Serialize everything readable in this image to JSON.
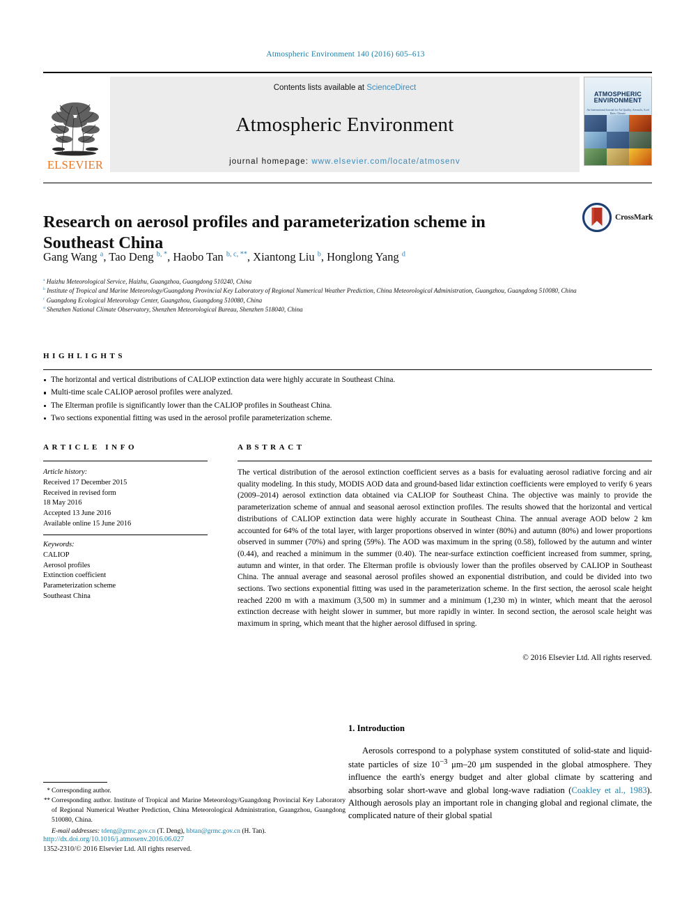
{
  "running_head": "Atmospheric Environment 140 (2016) 605–613",
  "banner": {
    "publisher": "ELSEVIER",
    "contents_prefix": "Contents lists available at ",
    "contents_link": "ScienceDirect",
    "journal_name": "Atmospheric Environment",
    "homepage_prefix": "journal homepage: ",
    "homepage_url": "www.elsevier.com/locate/atmosenv",
    "cover_title_line1": "ATMOSPHERIC",
    "cover_title_line2": "ENVIRONMENT",
    "cover_subtitle": "An International Journal for Air Quality, Aerosols, Acid Rain, Climate"
  },
  "article": {
    "title": "Research on aerosol profiles and parameterization scheme in Southeast China",
    "crossmark_label": "CrossMark",
    "authors": [
      {
        "name": "Gang Wang",
        "marks": "a"
      },
      {
        "name": "Tao Deng",
        "marks": "b, *"
      },
      {
        "name": "Haobo Tan",
        "marks": "b, c, **"
      },
      {
        "name": "Xiantong Liu",
        "marks": "b"
      },
      {
        "name": "Honglong Yang",
        "marks": "d"
      }
    ],
    "affiliations": [
      {
        "mark": "a",
        "text": "Haizhu Meteorological Service, Haizhu, Guangzhou, Guangdong 510240, China"
      },
      {
        "mark": "b",
        "text": "Institute of Tropical and Marine Meteorology/Guangdong Provincial Key Laboratory of Regional Numerical Weather Prediction, China Meteorological Administration, Guangzhou, Guangdong 510080, China"
      },
      {
        "mark": "c",
        "text": "Guangdong Ecological Meteorology Center, Guangzhou, Guangdong 510080, China"
      },
      {
        "mark": "d",
        "text": "Shenzhen National Climate Observatory, Shenzhen Meteorological Bureau, Shenzhen 518040, China"
      }
    ]
  },
  "highlights": {
    "heading": "HIGHLIGHTS",
    "items": [
      "The horizontal and vertical distributions of CALIOP extinction data were highly accurate in Southeast China.",
      "Multi-time scale CALIOP aerosol profiles were analyzed.",
      "The Elterman profile is significantly lower than the CALIOP profiles in Southeast China.",
      "Two sections exponential fitting was used in the aerosol profile parameterization scheme."
    ]
  },
  "article_info": {
    "heading": "ARTICLE INFO",
    "history_label": "Article history:",
    "history": [
      "Received 17 December 2015",
      "Received in revised form",
      "18 May 2016",
      "Accepted 13 June 2016",
      "Available online 15 June 2016"
    ],
    "keywords_label": "Keywords:",
    "keywords": [
      "CALIOP",
      "Aerosol profiles",
      "Extinction coefficient",
      "Parameterization scheme",
      "Southeast China"
    ]
  },
  "abstract": {
    "heading": "ABSTRACT",
    "text": "The vertical distribution of the aerosol extinction coefficient serves as a basis for evaluating aerosol radiative forcing and air quality modeling. In this study, MODIS AOD data and ground-based lidar extinction coefficients were employed to verify 6 years (2009–2014) aerosol extinction data obtained via CALIOP for Southeast China. The objective was mainly to provide the parameterization scheme of annual and seasonal aerosol extinction profiles. The results showed that the horizontal and vertical distributions of CALIOP extinction data were highly accurate in Southeast China. The annual average AOD below 2 km accounted for 64% of the total layer, with larger proportions observed in winter (80%) and autumn (80%) and lower proportions observed in summer (70%) and spring (59%). The AOD was maximum in the spring (0.58), followed by the autumn and winter (0.44), and reached a minimum in the summer (0.40). The near-surface extinction coefficient increased from summer, spring, autumn and winter, in that order. The Elterman profile is obviously lower than the profiles observed by CALIOP in Southeast China. The annual average and seasonal aerosol profiles showed an exponential distribution, and could be divided into two sections. Two sections exponential fitting was used in the parameterization scheme. In the first section, the aerosol scale height reached 2200 m with a maximum (3,500 m) in summer and a minimum (1,230 m) in winter, which meant that the aerosol extinction decrease with height slower in summer, but more rapidly in winter. In second section, the aerosol scale height was maximum in spring, which meant that the higher aerosol diffused in spring.",
    "copyright": "© 2016 Elsevier Ltd. All rights reserved."
  },
  "introduction": {
    "heading": "1. Introduction",
    "paragraph_part1": "Aerosols correspond to a polyphase system constituted of solid-state and liquid-state particles of size 10",
    "superscript": "−3",
    "paragraph_part2": " μm–20 μm suspended in the global atmosphere. They influence the earth's energy budget and alter global climate by scattering and absorbing solar short-wave and global long-wave radiation (",
    "citation": "Coakley et al., 1983",
    "paragraph_part3": "). Although aerosols play an important role in changing global and regional climate, the complicated nature of their global spatial"
  },
  "footnotes": {
    "single_star_mark": "*",
    "single_star_text": "Corresponding author.",
    "double_star_mark": "**",
    "double_star_text": "Corresponding author. Institute of Tropical and Marine Meteorology/Guangdong Provincial Key Laboratory of Regional Numerical Weather Prediction, China Meteorological Administration, Guangzhou, Guangdong 510080, China.",
    "email_label": "E-mail addresses:",
    "email1": "tdeng@grmc.gov.cn",
    "email1_owner": "(T. Deng)",
    "email2": "hbtan@grmc.gov.cn",
    "email2_owner": "(H. Tan)."
  },
  "footer": {
    "doi": "http://dx.doi.org/10.1016/j.atmosenv.2016.06.027",
    "issn": "1352-2310/© 2016 Elsevier Ltd. All rights reserved."
  },
  "colors": {
    "link_blue": "#1a7fa8",
    "sciencedirect_blue": "#3a8bbb",
    "elsevier_orange": "#e87722",
    "author_mark_blue": "#2e7eb0",
    "crossmark_blue": "#1f3f73",
    "crossmark_red": "#b8301f"
  }
}
